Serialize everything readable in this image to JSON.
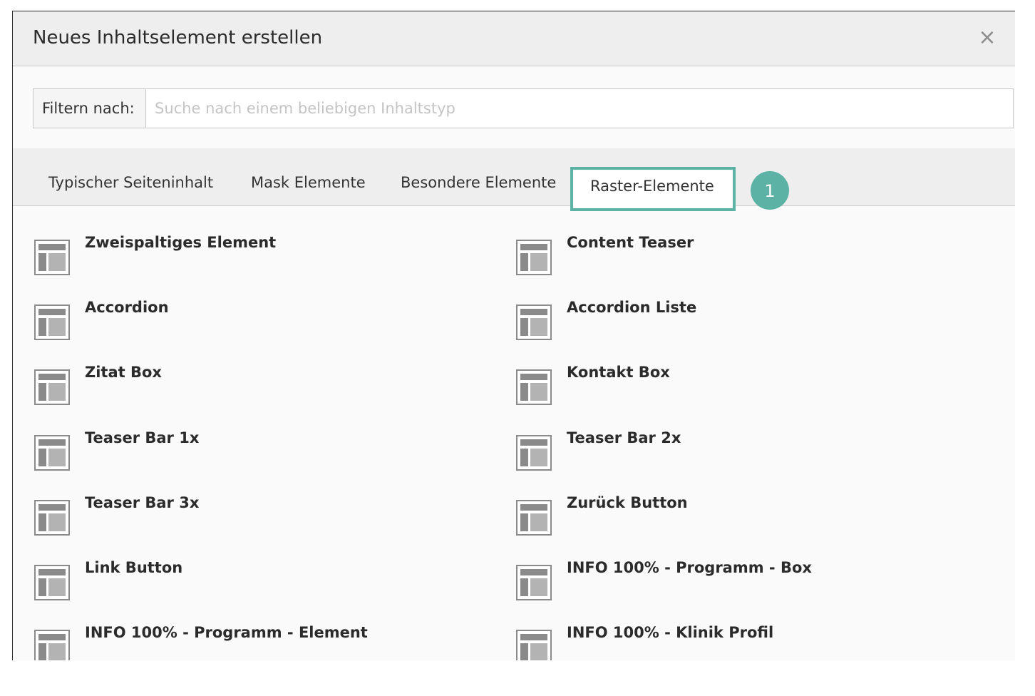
{
  "modal": {
    "title": "Neues Inhaltselement erstellen",
    "close_label": "×"
  },
  "filter": {
    "label": "Filtern nach:",
    "placeholder": "Suche nach einem beliebigen Inhaltstyp",
    "value": ""
  },
  "tabs": [
    {
      "label": "Typischer Seiteninhalt",
      "active": false
    },
    {
      "label": "Mask Elemente",
      "active": false
    },
    {
      "label": "Besondere Elemente",
      "active": false
    },
    {
      "label": "Raster-Elemente",
      "active": true
    }
  ],
  "annotation": {
    "badge": "1",
    "color": "#5cb2a4"
  },
  "items": {
    "left": [
      {
        "label": "Zweispaltiges Element",
        "icon": "grid-layout-icon"
      },
      {
        "label": "Accordion",
        "icon": "grid-layout-icon"
      },
      {
        "label": "Zitat Box",
        "icon": "grid-layout-icon"
      },
      {
        "label": "Teaser Bar 1x",
        "icon": "grid-layout-icon"
      },
      {
        "label": "Teaser Bar 3x",
        "icon": "grid-layout-icon"
      },
      {
        "label": "Link Button",
        "icon": "grid-layout-icon"
      },
      {
        "label": "INFO 100% - Programm - Element",
        "icon": "grid-layout-icon"
      }
    ],
    "right": [
      {
        "label": "Content Teaser",
        "icon": "grid-layout-icon"
      },
      {
        "label": "Accordion Liste",
        "icon": "grid-layout-icon"
      },
      {
        "label": "Kontakt Box",
        "icon": "grid-layout-icon"
      },
      {
        "label": "Teaser Bar 2x",
        "icon": "grid-layout-icon"
      },
      {
        "label": "Zurück Button",
        "icon": "grid-layout-icon"
      },
      {
        "label": "INFO 100% - Programm - Box",
        "icon": "grid-layout-icon"
      },
      {
        "label": "INFO 100% - Klinik Profil",
        "icon": "grid-layout-icon"
      }
    ]
  }
}
